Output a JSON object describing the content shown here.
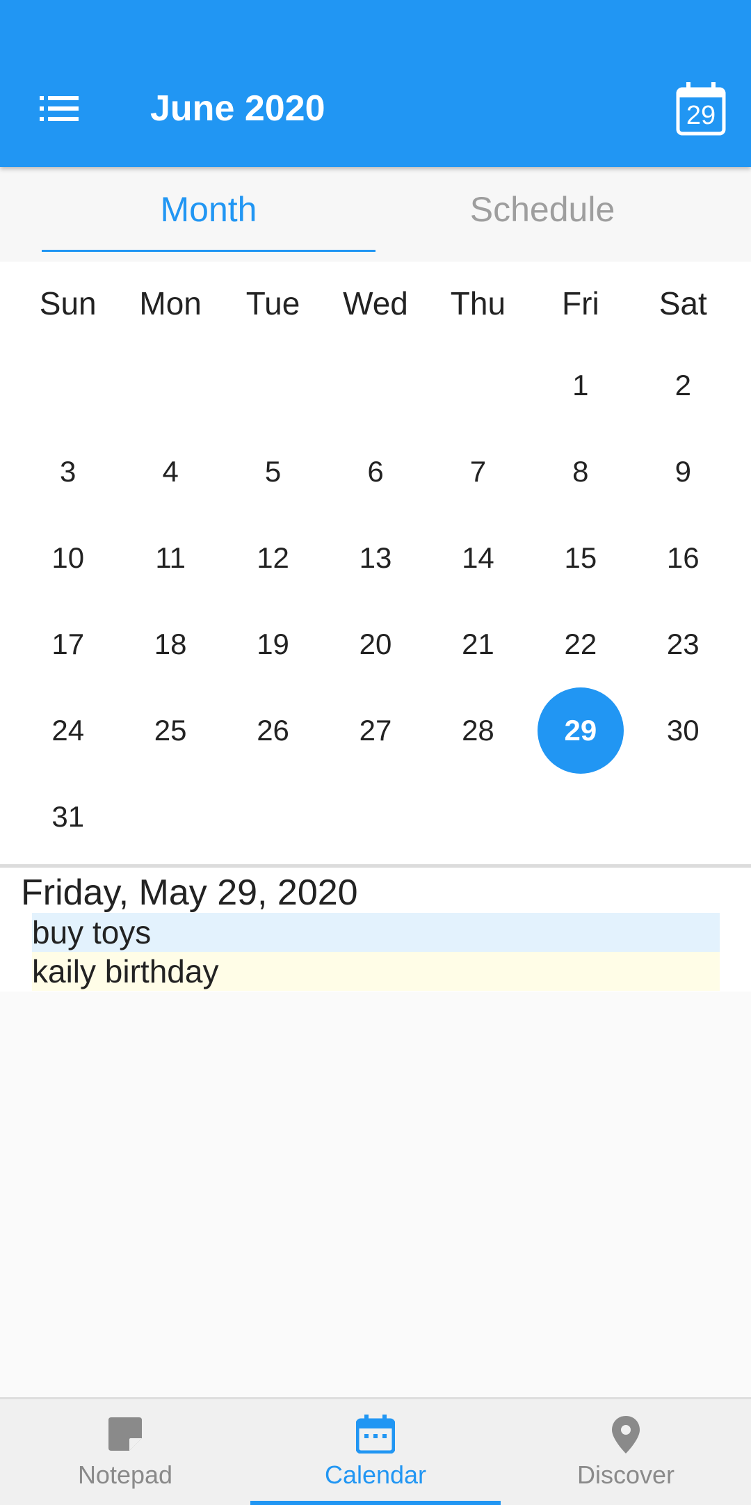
{
  "appbar": {
    "title": "June 2020",
    "today_label": "29",
    "menu_icon": "list-icon",
    "today_icon": "calendar-today-icon"
  },
  "tabs": [
    {
      "label": "Month",
      "active": true
    },
    {
      "label": "Schedule",
      "active": false
    }
  ],
  "calendar": {
    "weekdays": [
      "Sun",
      "Mon",
      "Tue",
      "Wed",
      "Thu",
      "Fri",
      "Sat"
    ],
    "weeks": [
      [
        "",
        "",
        "",
        "",
        "",
        "1",
        "2"
      ],
      [
        "3",
        "4",
        "5",
        "6",
        "7",
        "8",
        "9"
      ],
      [
        "10",
        "11",
        "12",
        "13",
        "14",
        "15",
        "16"
      ],
      [
        "17",
        "18",
        "19",
        "20",
        "21",
        "22",
        "23"
      ],
      [
        "24",
        "25",
        "26",
        "27",
        "28",
        "29",
        "30"
      ],
      [
        "31",
        "",
        "",
        "",
        "",
        "",
        ""
      ]
    ],
    "selected_day": "29"
  },
  "events": {
    "date_heading": "Friday, May 29, 2020",
    "items": [
      {
        "text": "buy toys",
        "color": "#e3f2fd"
      },
      {
        "text": "kaily birthday",
        "color": "#fffde7"
      }
    ]
  },
  "bottom_nav": {
    "items": [
      {
        "label": "Notepad",
        "icon": "note-icon",
        "active": false
      },
      {
        "label": "Calendar",
        "icon": "calendar-icon",
        "active": true
      },
      {
        "label": "Discover",
        "icon": "location-pin-icon",
        "active": false
      }
    ]
  },
  "colors": {
    "primary": "#2196f3",
    "inactive": "#8a8a8a"
  }
}
